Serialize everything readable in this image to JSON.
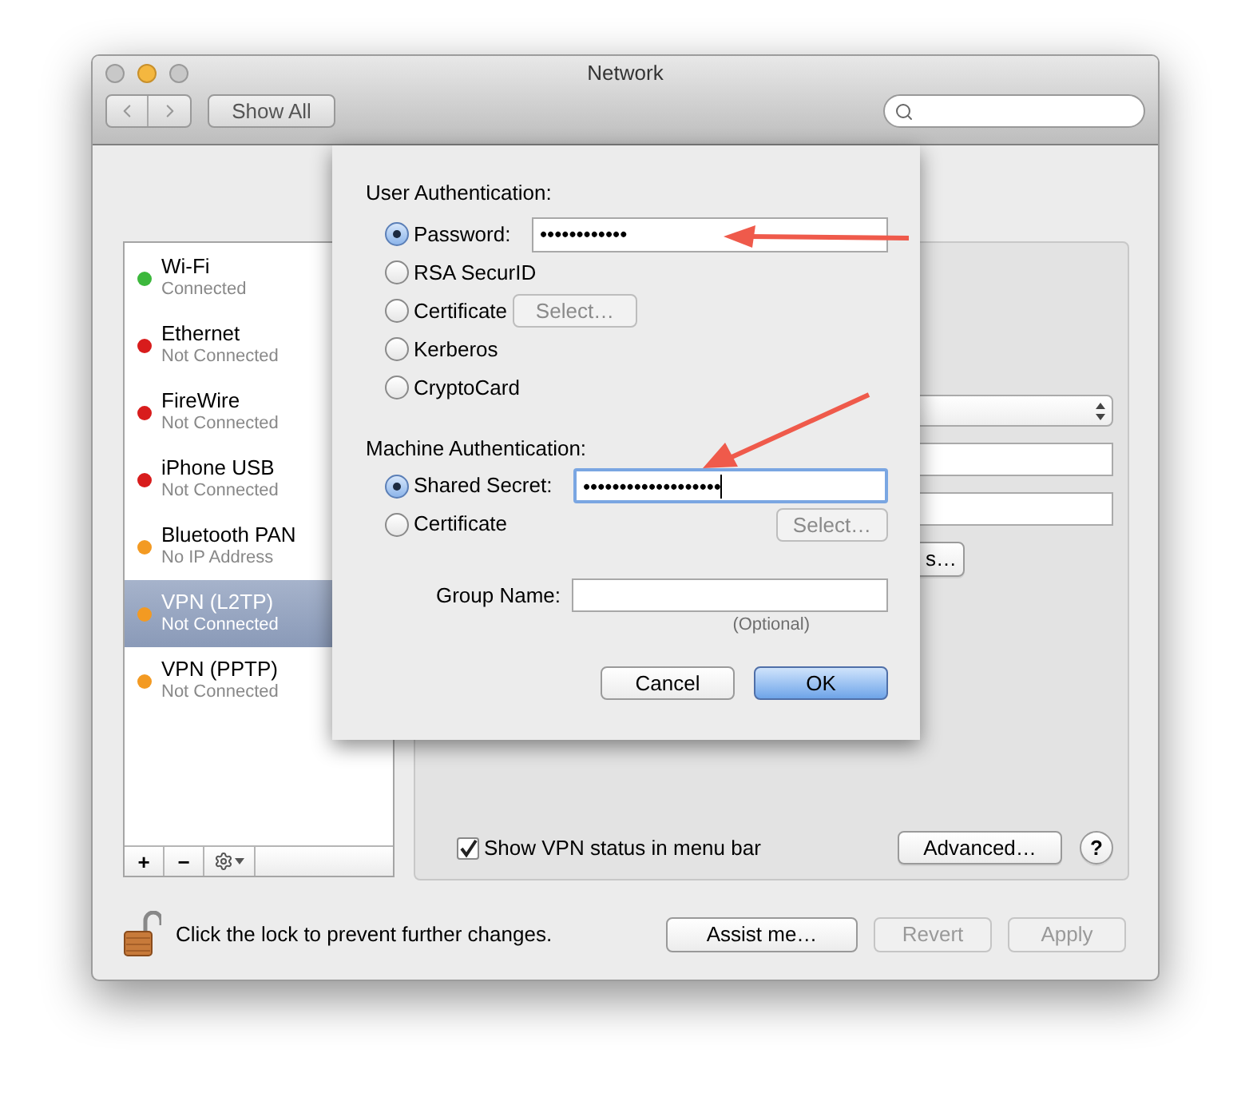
{
  "window": {
    "title": "Network"
  },
  "toolbar": {
    "show_all": "Show All"
  },
  "services": [
    {
      "name": "Wi-Fi",
      "status": "Connected",
      "color": "#3cb83c",
      "selected": false
    },
    {
      "name": "Ethernet",
      "status": "Not Connected",
      "color": "#d81c1c",
      "selected": false
    },
    {
      "name": "FireWire",
      "status": "Not Connected",
      "color": "#d81c1c",
      "selected": false
    },
    {
      "name": "iPhone USB",
      "status": "Not Connected",
      "color": "#d81c1c",
      "selected": false
    },
    {
      "name": "Bluetooth PAN",
      "status": "No IP Address",
      "color": "#f39a22",
      "selected": false
    },
    {
      "name": "VPN (L2TP)",
      "status": "Not Connected",
      "color": "#f39a22",
      "selected": true
    },
    {
      "name": "VPN (PPTP)",
      "status": "Not Connected",
      "color": "#f39a22",
      "selected": false
    }
  ],
  "list_buttons": [
    "+",
    "−"
  ],
  "detail": {
    "auth_settings_tail": "s…",
    "show_vpn_status": {
      "label": "Show VPN status in menu bar",
      "checked": true
    },
    "advanced": "Advanced…",
    "help": "?"
  },
  "footer": {
    "lock_text": "Click the lock to prevent further changes.",
    "buttons": [
      {
        "label": "Assist me…",
        "disabled": false
      },
      {
        "label": "Revert",
        "disabled": true
      },
      {
        "label": "Apply",
        "disabled": true
      }
    ]
  },
  "sheet": {
    "user_heading": "User Authentication:",
    "user_options": [
      {
        "label": "Password:",
        "selected": true,
        "kind": "field",
        "value": "••••••••••••"
      },
      {
        "label": "RSA SecurID",
        "selected": false,
        "kind": "plain"
      },
      {
        "label": "Certificate",
        "selected": false,
        "kind": "select",
        "button": "Select…"
      },
      {
        "label": "Kerberos",
        "selected": false,
        "kind": "plain"
      },
      {
        "label": "CryptoCard",
        "selected": false,
        "kind": "plain"
      }
    ],
    "machine_heading": "Machine Authentication:",
    "machine_options": [
      {
        "label": "Shared Secret:",
        "selected": true,
        "kind": "field",
        "value": "•••••••••••••••••••"
      },
      {
        "label": "Certificate",
        "selected": false,
        "kind": "select",
        "button": "Select…"
      }
    ],
    "group_name": {
      "label": "Group Name:",
      "hint": "(Optional)"
    },
    "buttons": [
      {
        "label": "Cancel",
        "default": false
      },
      {
        "label": "OK",
        "default": true
      }
    ]
  }
}
